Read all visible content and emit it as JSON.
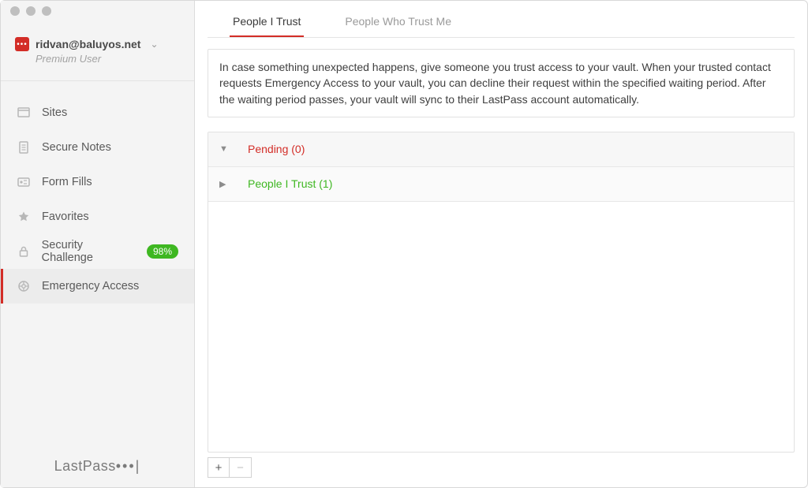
{
  "account": {
    "email": "ridvan@baluyos.net",
    "tier": "Premium User"
  },
  "sidebar": {
    "items": [
      {
        "label": "Sites"
      },
      {
        "label": "Secure Notes"
      },
      {
        "label": "Form Fills"
      },
      {
        "label": "Favorites"
      },
      {
        "label": "Security Challenge",
        "badge": "98%"
      },
      {
        "label": "Emergency Access"
      }
    ]
  },
  "brand": {
    "name_a": "Last",
    "name_b": "Pass",
    "dots": "•••|"
  },
  "tabs": {
    "active": "People I Trust",
    "inactive": "People Who Trust Me"
  },
  "description": "In case something unexpected happens, give someone you trust access to your vault. When your trusted contact requests Emergency Access to your vault, you can decline their request within the specified waiting period. After the waiting period passes, your vault will sync to their LastPass account automatically.",
  "groups": {
    "pending": "Pending (0)",
    "trusted": "People I Trust (1)"
  },
  "buttons": {
    "add": "+",
    "remove": "−"
  }
}
